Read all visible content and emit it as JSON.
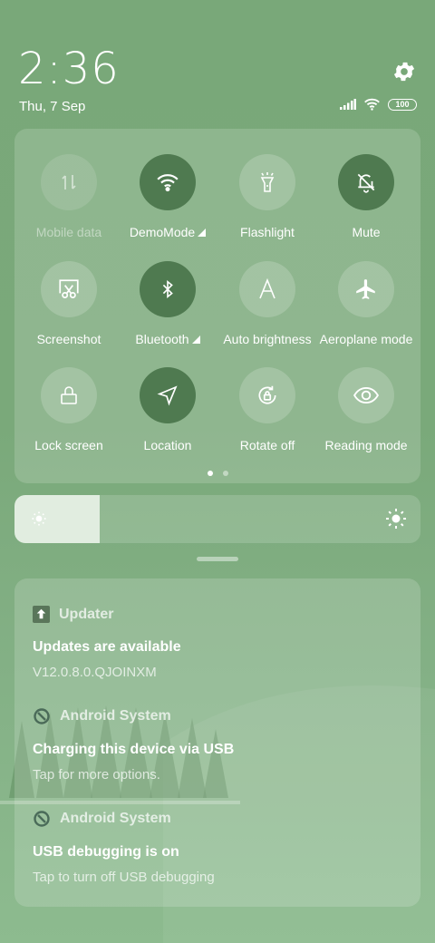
{
  "status": {
    "time": "2:36",
    "date": "Thu, 7 Sep",
    "battery": "100"
  },
  "tiles": [
    {
      "id": "mobile-data",
      "label": "Mobile data",
      "state": "disabled",
      "icon": "mobile-data-icon"
    },
    {
      "id": "wifi",
      "label": "DemoMode",
      "state": "active",
      "icon": "wifi-icon",
      "has_more": true
    },
    {
      "id": "flashlight",
      "label": "Flashlight",
      "state": "off",
      "icon": "flashlight-icon"
    },
    {
      "id": "mute",
      "label": "Mute",
      "state": "active",
      "icon": "bell-off-icon"
    },
    {
      "id": "screenshot",
      "label": "Screenshot",
      "state": "off",
      "icon": "scissors-icon"
    },
    {
      "id": "bluetooth",
      "label": "Bluetooth",
      "state": "active",
      "icon": "bluetooth-icon",
      "has_more": true
    },
    {
      "id": "auto-brightness",
      "label": "Auto brightness",
      "state": "off",
      "icon": "auto-brightness-icon"
    },
    {
      "id": "aeroplane",
      "label": "Aeroplane mode",
      "state": "off",
      "icon": "airplane-icon"
    },
    {
      "id": "lock-screen",
      "label": "Lock screen",
      "state": "off",
      "icon": "lock-icon"
    },
    {
      "id": "location",
      "label": "Location",
      "state": "active",
      "icon": "location-icon"
    },
    {
      "id": "rotate",
      "label": "Rotate off",
      "state": "off",
      "icon": "rotate-lock-icon"
    },
    {
      "id": "reading",
      "label": "Reading mode",
      "state": "off",
      "icon": "eye-icon"
    }
  ],
  "pager": {
    "pages": 2,
    "current": 1
  },
  "brightness": {
    "level": 0.21
  },
  "notifications": [
    {
      "app": "Updater",
      "title": "Updates are available",
      "text": "V12.0.8.0.QJOINXM",
      "icon": "updater-icon"
    },
    {
      "app": "Android System",
      "title": "Charging this device via USB",
      "text": "Tap for more options.",
      "icon": "android-system-icon"
    },
    {
      "app": "Android System",
      "title": "USB debugging is on",
      "text": "Tap to turn off USB debugging",
      "icon": "android-system-icon"
    }
  ],
  "colors": {
    "background": "#7aa97a",
    "active_tile": "#4f7a50"
  }
}
